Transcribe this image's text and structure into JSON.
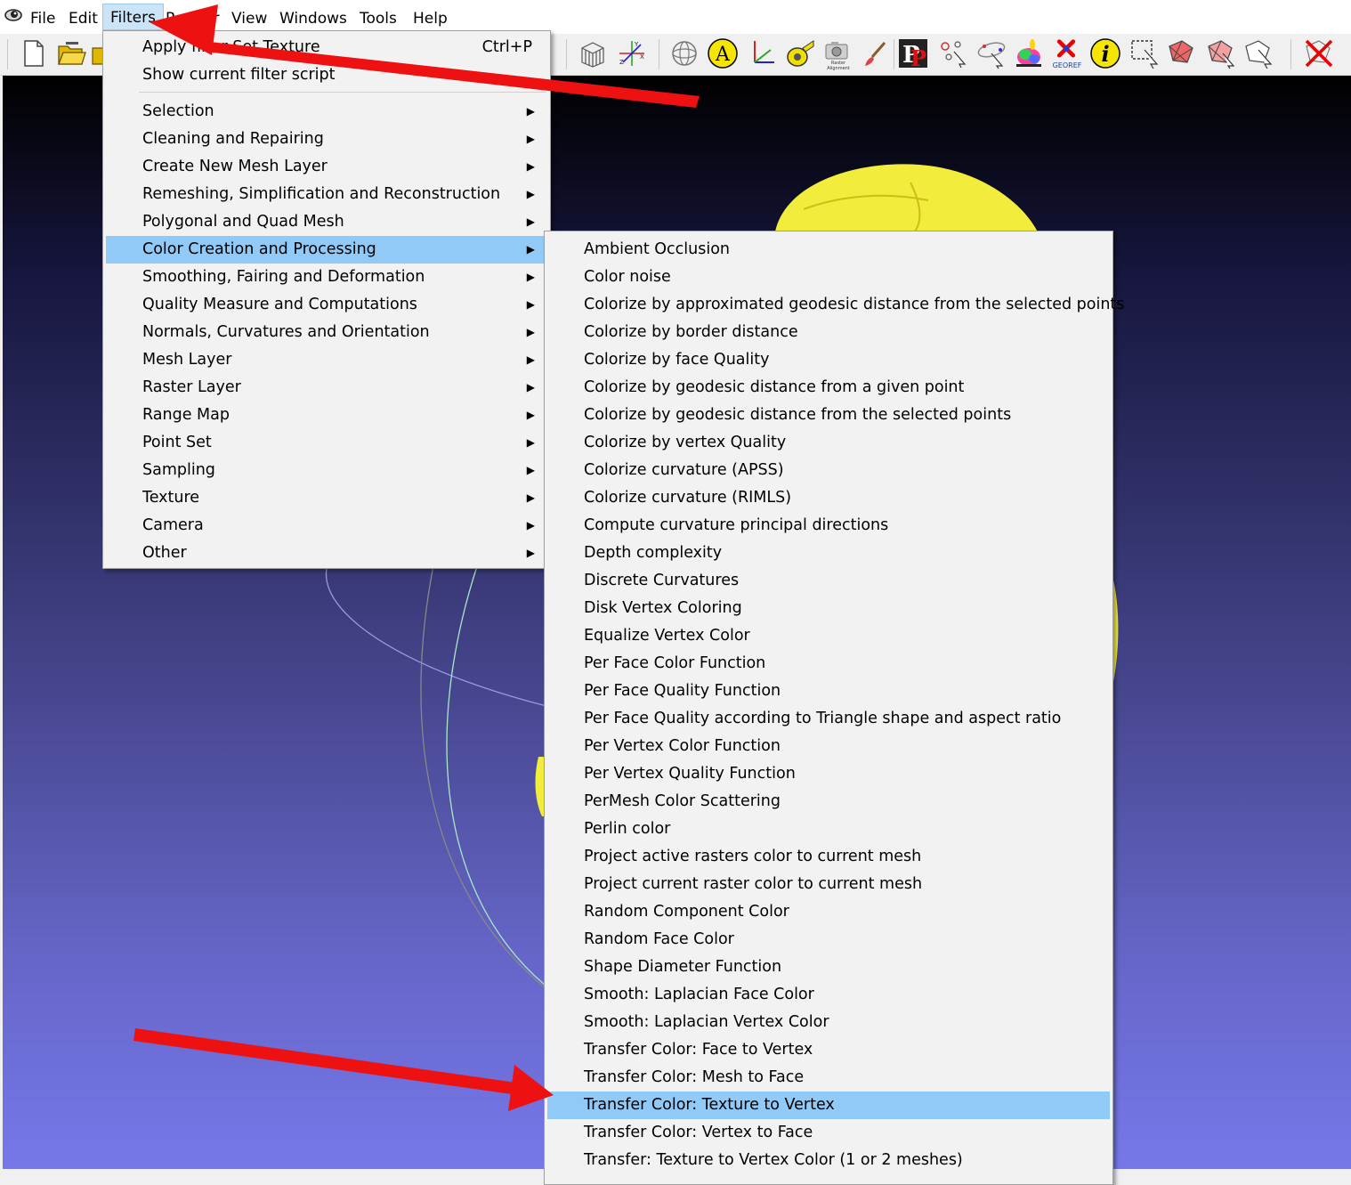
{
  "menubar": {
    "items": [
      "File",
      "Edit",
      "Filters",
      "Render",
      "View",
      "Windows",
      "Tools",
      "Help"
    ]
  },
  "toolbar": {
    "raster_alignment_label": "Raster Alignment",
    "georef_label": "GEOREF"
  },
  "filters_menu": {
    "top_items": [
      {
        "label": "Apply filter Set Texture",
        "shortcut": "Ctrl+P"
      },
      {
        "label": "Show current filter script"
      }
    ],
    "submenus": [
      "Selection",
      "Cleaning and Repairing",
      "Create New Mesh Layer",
      "Remeshing, Simplification and Reconstruction",
      "Polygonal and Quad Mesh",
      "Color Creation and Processing",
      "Smoothing, Fairing and Deformation",
      "Quality Measure and Computations",
      "Normals, Curvatures and Orientation",
      "Mesh Layer",
      "Raster Layer",
      "Range Map",
      "Point Set",
      "Sampling",
      "Texture",
      "Camera",
      "Other"
    ],
    "highlighted": "Color Creation and Processing"
  },
  "color_submenu": {
    "items": [
      "Ambient Occlusion",
      "Color noise",
      "Colorize by approximated geodesic distance from the selected points",
      "Colorize by border distance",
      "Colorize by face Quality",
      "Colorize by geodesic distance from a given point",
      "Colorize by geodesic distance from the selected points",
      "Colorize by vertex Quality",
      "Colorize curvature (APSS)",
      "Colorize curvature (RIMLS)",
      "Compute curvature principal directions",
      "Depth complexity",
      "Discrete Curvatures",
      "Disk Vertex Coloring",
      "Equalize Vertex Color",
      "Per Face Color Function",
      "Per Face Quality Function",
      "Per Face Quality according to Triangle shape and aspect ratio",
      "Per Vertex Color Function",
      "Per Vertex Quality Function",
      "PerMesh Color Scattering",
      "Perlin color",
      "Project active rasters color to current mesh",
      "Project current raster color to current mesh",
      "Random Component Color",
      "Random Face Color",
      "Shape Diameter Function",
      "Smooth: Laplacian Face Color",
      "Smooth: Laplacian Vertex Color",
      "Transfer Color: Face to Vertex",
      "Transfer Color: Mesh to Face",
      "Transfer Color: Texture to Vertex",
      "Transfer Color: Vertex to Face",
      "Transfer: Texture to Vertex Color (1 or 2 meshes)"
    ],
    "highlighted": "Transfer Color: Texture to Vertex"
  },
  "colors": {
    "highlight": "#91c9f7",
    "menu_bg": "#f2f2f2",
    "mesh_yellow": "#f2ec3c",
    "arrow_red": "#ee1111"
  },
  "icons": [
    "app-logo-icon",
    "new-file-icon",
    "open-folder-icon",
    "open-project-icon",
    "bounding-box-icon",
    "axes-icon",
    "sphere-icon",
    "annotate-a-icon",
    "axis-trihedron-icon",
    "measure-tape-icon",
    "raster-alignment-camera-icon",
    "paint-brush-icon",
    "pickpoints-icon",
    "point-align-icon",
    "manipulator-icon",
    "colored-bunny-icon",
    "georef-icon",
    "info-icon",
    "select-rect-icon",
    "select-faces-icon",
    "select-vertices-icon",
    "select-connected-icon",
    "delete-selection-icon"
  ]
}
